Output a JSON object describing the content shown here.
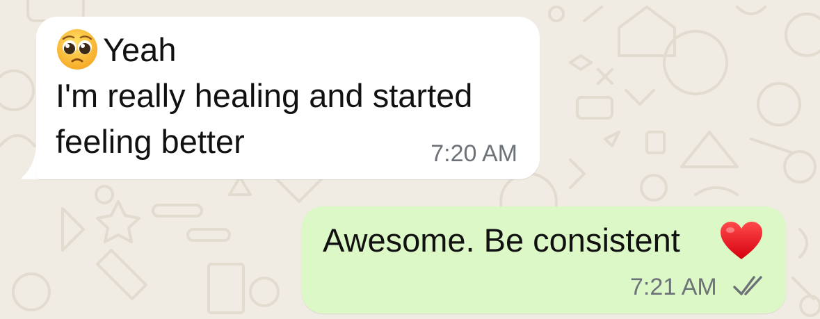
{
  "conversation": {
    "incoming": {
      "emoji_icon": "pleading-face-icon",
      "line1": "Yeah",
      "line2": "I'm really healing and started",
      "line3": "feeling better",
      "time": "7:20 AM"
    },
    "outgoing": {
      "text": "Awesome. Be consistent",
      "emoji_icon": "red-heart-icon",
      "time": "7:21 AM",
      "status_icon": "double-check-icon"
    }
  },
  "colors": {
    "background": "#f0ebe3",
    "incoming_bubble": "#ffffff",
    "outgoing_bubble": "#dcf8c6",
    "timestamp": "#6d7278"
  }
}
